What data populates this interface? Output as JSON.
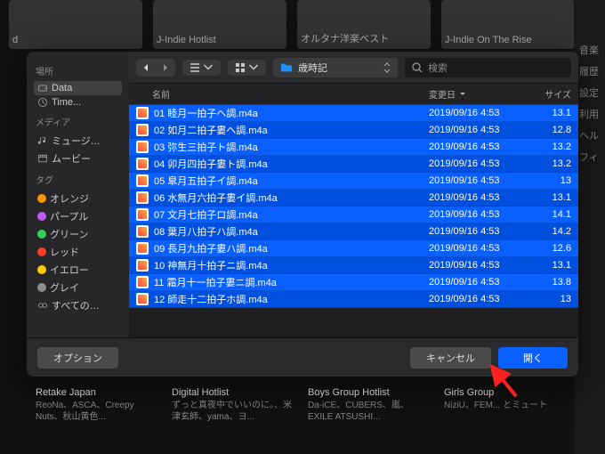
{
  "bg": {
    "top_cards": [
      "d",
      "J-Indie Hotlist",
      "オルタナ洋楽ベスト",
      "J-Indie On The Rise"
    ],
    "right": [
      "音楽",
      "履歴",
      "設定",
      "利用",
      "ヘル",
      "フィ"
    ],
    "albums": [
      {
        "title": "Retake Japan",
        "sub": "ReoNa、ASCA、Creepy Nuts、秋山黄色..."
      },
      {
        "title": "Digital Hotlist",
        "sub": "ずっと真夜中でいいのに。、米津玄師、yama、ヨ..."
      },
      {
        "title": "Boys Group Hotlist",
        "sub": "Da-iCE、CUBERS、嵐、EXILE ATSUSHI..."
      },
      {
        "title": "Girls Group",
        "sub": "NiziU、FEM... とミュート"
      }
    ]
  },
  "sidebar": {
    "h1": "場所",
    "locations": [
      {
        "label": "Data",
        "sel": true,
        "icon": "drive"
      },
      {
        "label": "Time...",
        "sel": false,
        "icon": "clock"
      }
    ],
    "h2": "メディア",
    "media": [
      {
        "label": "ミュージ…",
        "icon": "music"
      },
      {
        "label": "ムービー",
        "icon": "movie"
      }
    ],
    "h3": "タグ",
    "tags": [
      {
        "label": "オレンジ",
        "color": "#ff9500"
      },
      {
        "label": "パープル",
        "color": "#bf5af2"
      },
      {
        "label": "グリーン",
        "color": "#30d158"
      },
      {
        "label": "レッド",
        "color": "#ff3b30"
      },
      {
        "label": "イエロー",
        "color": "#ffcc00"
      },
      {
        "label": "グレイ",
        "color": "#8e8e93"
      }
    ],
    "all": "すべての…"
  },
  "toolbar": {
    "folder": "歳時記",
    "search_placeholder": "検索"
  },
  "columns": {
    "name": "名前",
    "date": "変更日",
    "size": "サイズ"
  },
  "files": [
    {
      "name": "01 睦月一拍子ヘ調.m4a",
      "date": "2019/09/16 4:53",
      "size": "13.1"
    },
    {
      "name": "02 如月二拍子婁ヘ調.m4a",
      "date": "2019/09/16 4:53",
      "size": "12.8"
    },
    {
      "name": "03 弥生三拍子ト調.m4a",
      "date": "2019/09/16 4:53",
      "size": "13.2"
    },
    {
      "name": "04 卯月四拍子婁ト調.m4a",
      "date": "2019/09/16 4:53",
      "size": "13.2"
    },
    {
      "name": "05 皐月五拍子イ調.m4a",
      "date": "2019/09/16 4:53",
      "size": "13"
    },
    {
      "name": "06 水無月六拍子婁イ調.m4a",
      "date": "2019/09/16 4:53",
      "size": "13.1"
    },
    {
      "name": "07 文月七拍子ロ調.m4a",
      "date": "2019/09/16 4:53",
      "size": "14.1"
    },
    {
      "name": "08 葉月八拍子ハ調.m4a",
      "date": "2019/09/16 4:53",
      "size": "14.2"
    },
    {
      "name": "09 長月九拍子婁ハ調.m4a",
      "date": "2019/09/16 4:53",
      "size": "12.6"
    },
    {
      "name": "10 神無月十拍子ニ調.m4a",
      "date": "2019/09/16 4:53",
      "size": "13.1"
    },
    {
      "name": "11 霜月十一拍子婁ニ調.m4a",
      "date": "2019/09/16 4:53",
      "size": "13.8"
    },
    {
      "name": "12 師走十二拍子ホ調.m4a",
      "date": "2019/09/16 4:53",
      "size": "13"
    }
  ],
  "footer": {
    "options": "オプション",
    "cancel": "キャンセル",
    "open": "開く"
  }
}
